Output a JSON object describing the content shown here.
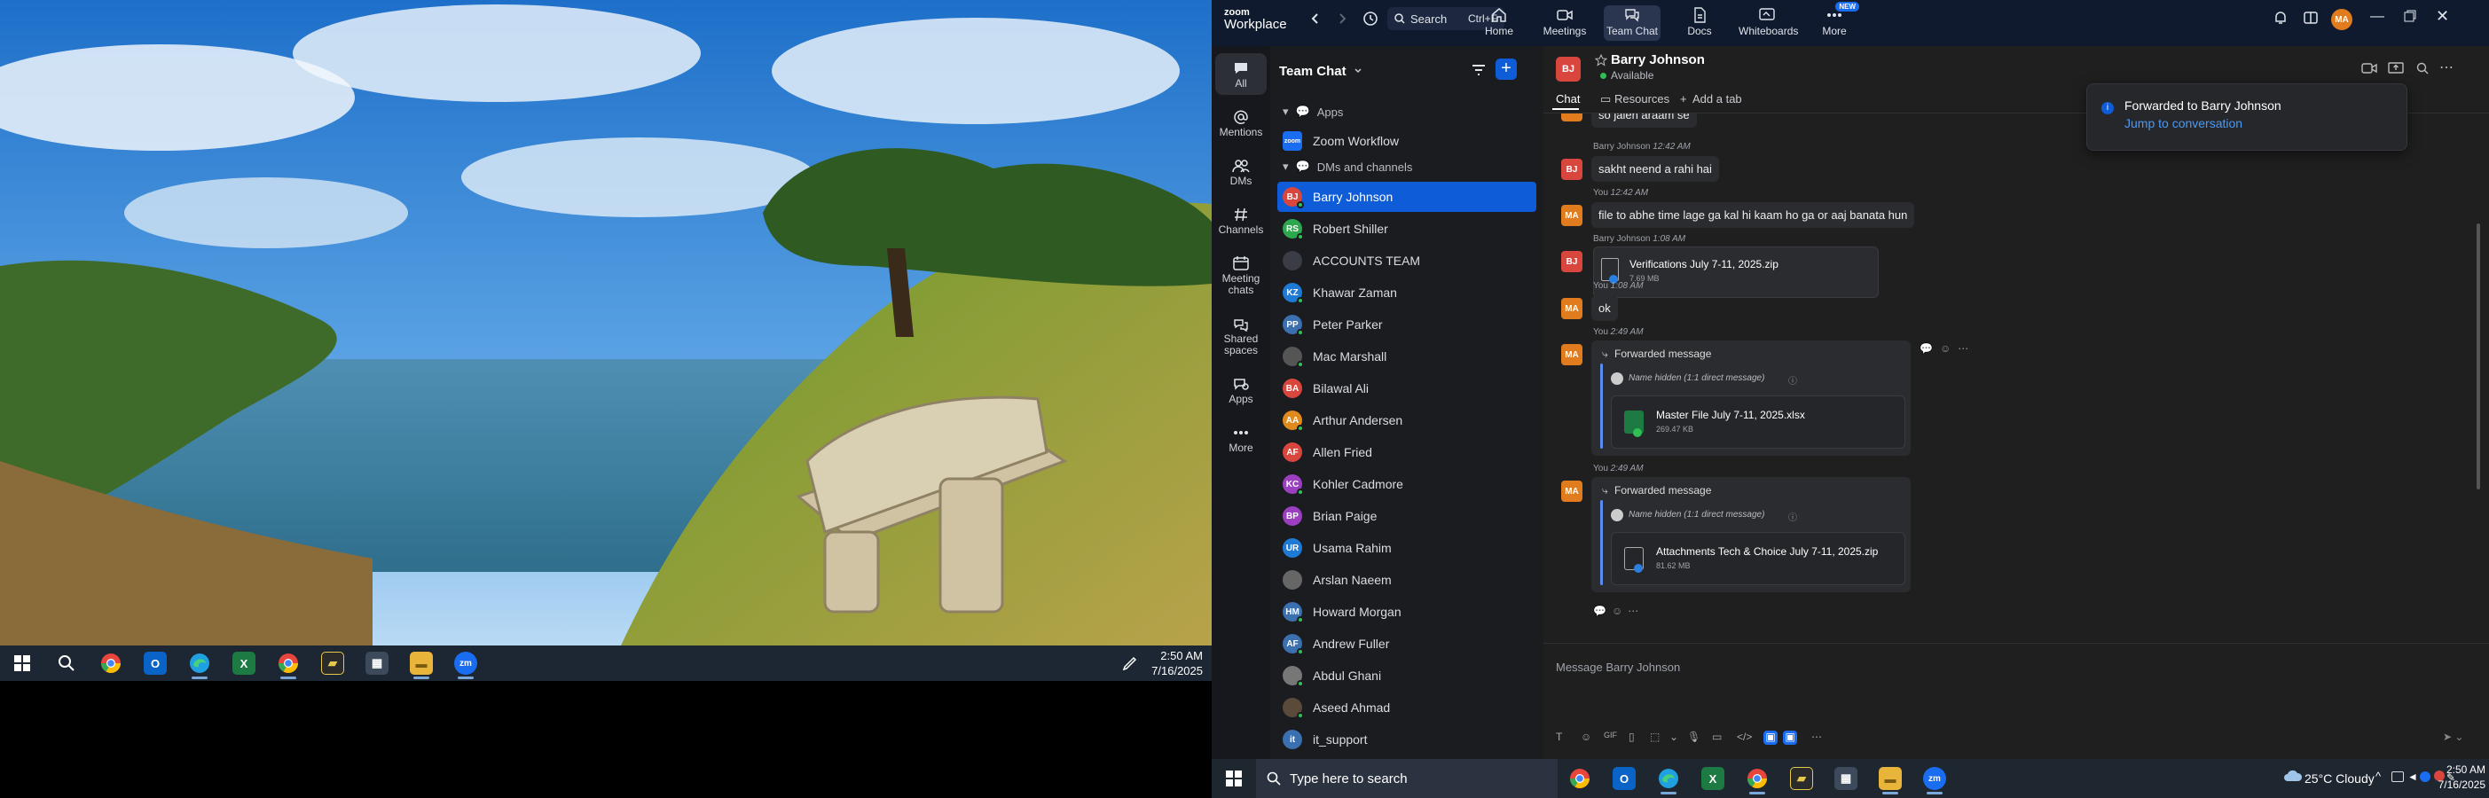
{
  "taskbar_left": {
    "apps": [
      "start-icon",
      "search-icon",
      "chrome-icon",
      "outlook-icon",
      "edge-icon",
      "excel-icon",
      "chrome-profile-icon",
      "sticky-notes-icon",
      "calculator-icon",
      "file-explorer-icon",
      "zoom-icon"
    ],
    "time": "2:50 AM",
    "date": "7/16/2025"
  },
  "zoom": {
    "brand_line1": "zoom",
    "brand_line2": "Workplace",
    "search_placeholder": "Search",
    "search_shortcut": "Ctrl+F",
    "nav": [
      {
        "label": "Home",
        "icon": "home-icon"
      },
      {
        "label": "Meetings",
        "icon": "video-icon"
      },
      {
        "label": "Team Chat",
        "icon": "chat-icon"
      },
      {
        "label": "Docs",
        "icon": "doc-icon"
      },
      {
        "label": "Whiteboards",
        "icon": "whiteboard-icon"
      },
      {
        "label": "More",
        "icon": "more-icon",
        "badge": "NEW"
      }
    ],
    "profile_initials": "MA",
    "rail": [
      {
        "label": "All"
      },
      {
        "label": "Mentions"
      },
      {
        "label": "DMs"
      },
      {
        "label": "Channels"
      },
      {
        "label": "Meeting chats"
      },
      {
        "label": "Shared spaces"
      },
      {
        "label": "Apps"
      },
      {
        "label": "More"
      }
    ],
    "panel_title": "Team Chat",
    "section_apps": "Apps",
    "app_item": "Zoom Workflow",
    "section_dms": "DMs and channels",
    "contacts": [
      {
        "name": "Barry Johnson",
        "initials": "BJ",
        "color": "#d9463e",
        "selected": true
      },
      {
        "name": "Robert Shiller",
        "initials": "RS",
        "color": "#2ea84f"
      },
      {
        "name": "ACCOUNTS TEAM",
        "initials": "",
        "color": "#3a3d45"
      },
      {
        "name": "Khawar Zaman",
        "initials": "KZ",
        "color": "#1f7ad6"
      },
      {
        "name": "Peter Parker",
        "initials": "PP",
        "color": "#3a6fb0"
      },
      {
        "name": "Mac Marshall",
        "initials": "",
        "color": "#555"
      },
      {
        "name": "Bilawal Ali",
        "initials": "BA",
        "color": "#d9463e"
      },
      {
        "name": "Arthur Andersen",
        "initials": "AA",
        "color": "#e08a1e"
      },
      {
        "name": "Allen Fried",
        "initials": "AF",
        "color": "#d9463e"
      },
      {
        "name": "Kohler Cadmore",
        "initials": "KC",
        "color": "#9b3fc0"
      },
      {
        "name": "Brian Paige",
        "initials": "BP",
        "color": "#9b3fc0"
      },
      {
        "name": "Usama Rahim",
        "initials": "UR",
        "color": "#1f7ad6"
      },
      {
        "name": "Arslan Naeem",
        "initials": "",
        "color": "#666"
      },
      {
        "name": "Howard Morgan",
        "initials": "HM",
        "color": "#3a6fb0"
      },
      {
        "name": "Andrew Fuller",
        "initials": "AF",
        "color": "#3a6fb0"
      },
      {
        "name": "Abdul Ghani",
        "initials": "",
        "color": "#777"
      },
      {
        "name": "Aseed Ahmad",
        "initials": "",
        "color": "#5a4a3a"
      },
      {
        "name": "it_support",
        "initials": "it",
        "color": "#3a6fb0"
      }
    ],
    "header": {
      "name": "Barry Johnson",
      "initials": "BJ",
      "status": "Available",
      "tabs": [
        "Chat",
        "Resources",
        "Add a tab"
      ]
    },
    "messages": [
      {
        "who": "MA",
        "text": "so jaien araam se"
      },
      {
        "who": "BJ",
        "sender": "Barry Johnson",
        "time": "12:42 AM",
        "text": "sakht neend a rahi hai"
      },
      {
        "who": "MA",
        "sender": "You",
        "time": "12:42 AM",
        "text": "file to abhe time lage ga kal hi kaam ho ga or aaj banata hun"
      },
      {
        "who": "BJ",
        "sender": "Barry Johnson",
        "time": "1:08 AM",
        "file": "Verifications July 7-11, 2025.zip",
        "size": "7.69 MB"
      },
      {
        "who": "MA",
        "sender": "You",
        "time": "1:08 AM",
        "text": "ok"
      },
      {
        "who": "MA",
        "sender": "You",
        "time": "2:49 AM",
        "forwarded": "Forwarded message",
        "origin": "Name hidden (1:1 direct message)",
        "file": "Master File July 7-11, 2025.xlsx",
        "size": "269.47 KB"
      },
      {
        "who": "MA",
        "sender": "You",
        "time": "2:49 AM",
        "forwarded": "Forwarded message",
        "origin": "Name hidden (1:1 direct message)",
        "file": "Attachments  Tech & Choice July 7-11, 2025.zip",
        "size": "81.62 MB"
      }
    ],
    "composer_placeholder": "Message Barry Johnson",
    "toast": {
      "title": "Forwarded to Barry Johnson",
      "link": "Jump to conversation"
    }
  },
  "taskbar_right": {
    "search_placeholder": "Type here to search",
    "weather": "25°C  Cloudy",
    "time": "2:50 AM",
    "date": "7/16/2025"
  },
  "colors": {
    "accent": "#0e5cd8",
    "selected_nav": "#2a3550",
    "available": "#2fbf54"
  }
}
